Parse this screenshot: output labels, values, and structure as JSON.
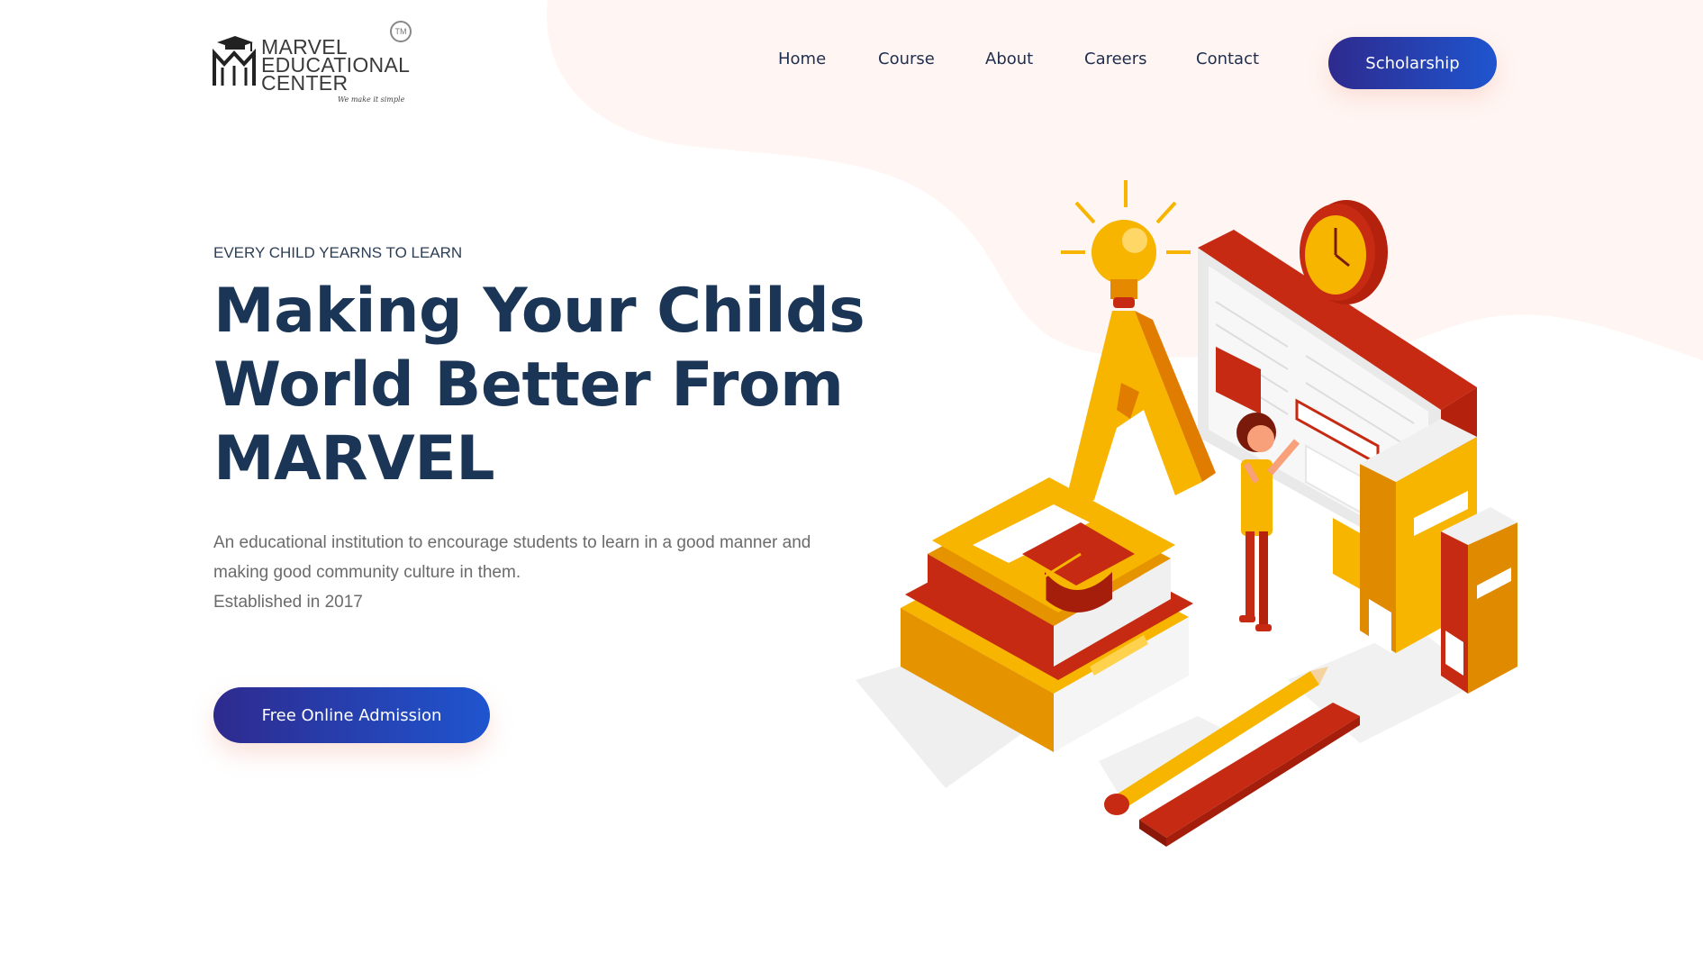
{
  "brand": {
    "line1": "MARVEL",
    "line2": "EDUCATIONAL",
    "line3": "CENTER",
    "tagline": "We make it simple",
    "tm": "TM"
  },
  "nav": {
    "items": [
      "Home",
      "Course",
      "About",
      "Careers",
      "Contact"
    ],
    "cta_label": "Scholarship"
  },
  "hero": {
    "eyebrow": "EVERY CHILD YEARNS TO LEARN",
    "headline_line1": "Making Your Childs",
    "headline_line2": "World Better From",
    "headline_line3": "MARVEL",
    "description": "An educational institution to encourage students to learn in a good manner and making good community culture in them.",
    "established": "Established in 2017",
    "cta_label": "Free Online Admission"
  },
  "illustration": {
    "description_icons": [
      "lightbulb-icon",
      "clock-icon",
      "books-icon",
      "graduation-cap-icon",
      "pencil-icon",
      "ruler-icon",
      "letter-a-icon",
      "student-figure"
    ]
  },
  "colors": {
    "headline": "#1b3557",
    "button_gradient_start": "#2e2a8e",
    "button_gradient_end": "#1f55cf",
    "blob": "#fff5f2",
    "accent_yellow": "#f7b500",
    "accent_red": "#c62a12"
  }
}
